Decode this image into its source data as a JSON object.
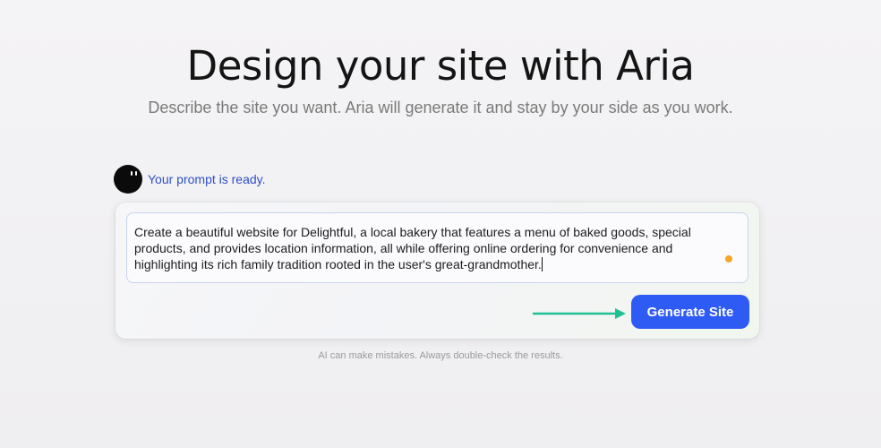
{
  "header": {
    "title": "Design your site with Aria",
    "subtitle": "Describe the site you want. Aria will generate it and stay by your side as you work."
  },
  "assistant": {
    "status": "Your prompt is ready."
  },
  "prompt": {
    "value": "Create a beautiful website for Delightful, a local bakery that features a menu of baked goods, special products, and provides location information, all while offering online ordering for convenience and highlighting its rich family tradition rooted in the user's great-grandmother."
  },
  "actions": {
    "generate_label": "Generate Site"
  },
  "footer": {
    "disclaimer": "AI can make mistakes. Always double-check the results."
  },
  "colors": {
    "accent": "#2f5bf5",
    "arrow": "#1fbf95",
    "status_text": "#2f4fc9",
    "recording_dot": "#f5a623"
  },
  "icons": {
    "avatar": "aria-avatar-icon",
    "arrow": "arrow-right-icon",
    "dot": "recording-dot-icon"
  }
}
